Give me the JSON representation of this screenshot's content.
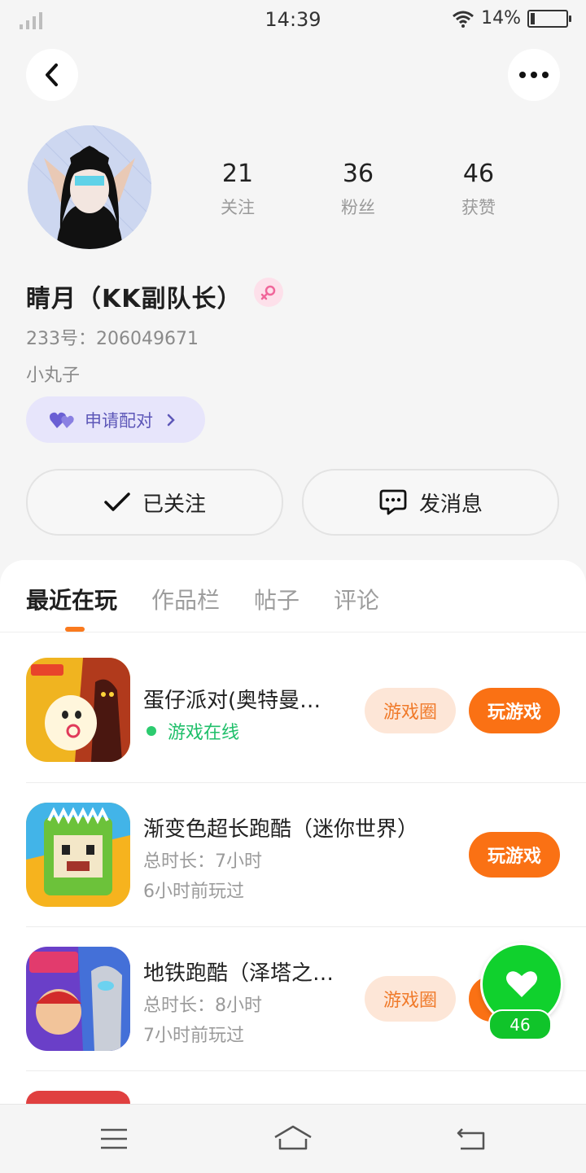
{
  "status_bar": {
    "time": "14:39",
    "battery": "14%"
  },
  "profile": {
    "name": "睛月（KK副队长）",
    "id_line": "233号：206049671",
    "signature": "小丸子",
    "pair_label": "申请配对",
    "stats": [
      {
        "value": "21",
        "label": "关注"
      },
      {
        "value": "36",
        "label": "粉丝"
      },
      {
        "value": "46",
        "label": "获赞"
      }
    ],
    "follow_label": "已关注",
    "message_label": "发消息"
  },
  "tabs": [
    "最近在玩",
    "作品栏",
    "帖子",
    "评论"
  ],
  "games": [
    {
      "title": "蛋仔派对(奥特曼…",
      "online": "游戏在线",
      "circle_label": "游戏圈",
      "play_label": "玩游戏"
    },
    {
      "title": "渐变色超长跑酷（迷你世界）",
      "duration": "总时长：7小时",
      "last_played": "6小时前玩过",
      "play_label": "玩游戏"
    },
    {
      "title": "地铁跑酷（泽塔之…",
      "duration": "总时长：8小时",
      "last_played": "7小时前玩过",
      "circle_label": "游戏圈"
    }
  ],
  "like_fab": {
    "count": "46"
  },
  "colors": {
    "accent": "#fa7114",
    "green": "#10d12d",
    "pair_bg": "#e7e5fb"
  }
}
